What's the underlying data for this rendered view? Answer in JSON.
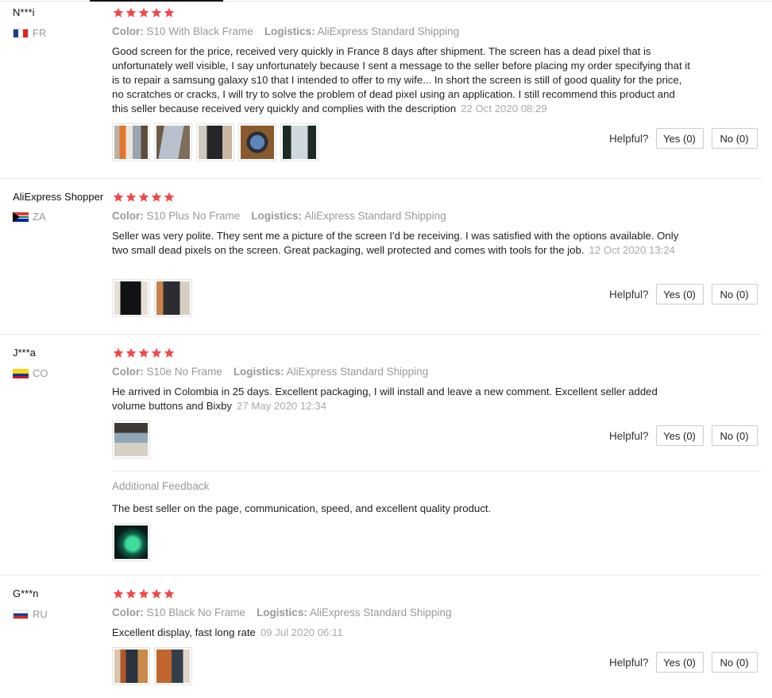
{
  "colors": {
    "star": "#f2464b",
    "muted": "#999999",
    "border": "#cccccc"
  },
  "helpful_label": "Helpful?",
  "meta_labels": {
    "color": "Color:",
    "logistics": "Logistics:"
  },
  "reviews": [
    {
      "user": "N***i",
      "country": "FR",
      "flag": "fr",
      "rating": 5,
      "color": "S10 With Black Frame",
      "logistics": "AliExpress Standard Shipping",
      "text": "Good screen for the price, received very quickly in France 8 days after shipment. The screen has a dead pixel that is unfortunately well visible, I say unfortunately because I sent a message to the seller before placing my order specifying that it is to repair a samsung galaxy s10 that I intended to offer to my wife... In short the screen is still of good quality for the price, no scratches or cracks, I will try to solve the problem of dead pixel using an application. I still recommend this product and this seller because received very quickly and complies with the description",
      "date": "22 Oct 2020 08:29",
      "yes": "Yes (0)",
      "no": "No (0)",
      "photos": [
        "phone-photo",
        "phone-photo",
        "phone-photo",
        "phone-photo",
        "phone-photo"
      ]
    },
    {
      "user": "AliExpress Shopper",
      "country": "ZA",
      "flag": "za",
      "rating": 5,
      "color": "S10 Plus No Frame",
      "logistics": "AliExpress Standard Shipping",
      "text": "Seller was very polite. They sent me a picture of the screen I'd be receiving. I was satisfied with the options available. Only two small dead pixels on the screen. Great packaging, well protected and comes with tools for the job.",
      "date": "12 Oct 2020 13:24",
      "yes": "Yes (0)",
      "no": "No (0)",
      "photos": [
        "phone-photo",
        "phone-photo"
      ]
    },
    {
      "user": "J***a",
      "country": "CO",
      "flag": "co",
      "rating": 5,
      "color": "S10e No Frame",
      "logistics": "AliExpress Standard Shipping",
      "text": "He arrived in Colombia in 25 days. Excellent packaging, I will install and leave a new comment. Excellent seller added volume buttons and Bixby",
      "date": "27 May 2020 12:34",
      "yes": "Yes (0)",
      "no": "No (0)",
      "photos": [
        "phone-photo"
      ],
      "additional_feedback": {
        "label": "Additional Feedback",
        "text": "The best seller on the page, communication, speed, and excellent quality product.",
        "photos": [
          "phone-photo"
        ]
      }
    },
    {
      "user": "G***n",
      "country": "RU",
      "flag": "ru",
      "rating": 5,
      "color": "S10 Black No Frame",
      "logistics": "AliExpress Standard Shipping",
      "text": "Excellent display, fast long rate",
      "date": "09 Jul 2020 06:11",
      "yes": "Yes (0)",
      "no": "No (0)",
      "photos": [
        "phone-photo",
        "phone-photo"
      ]
    }
  ]
}
